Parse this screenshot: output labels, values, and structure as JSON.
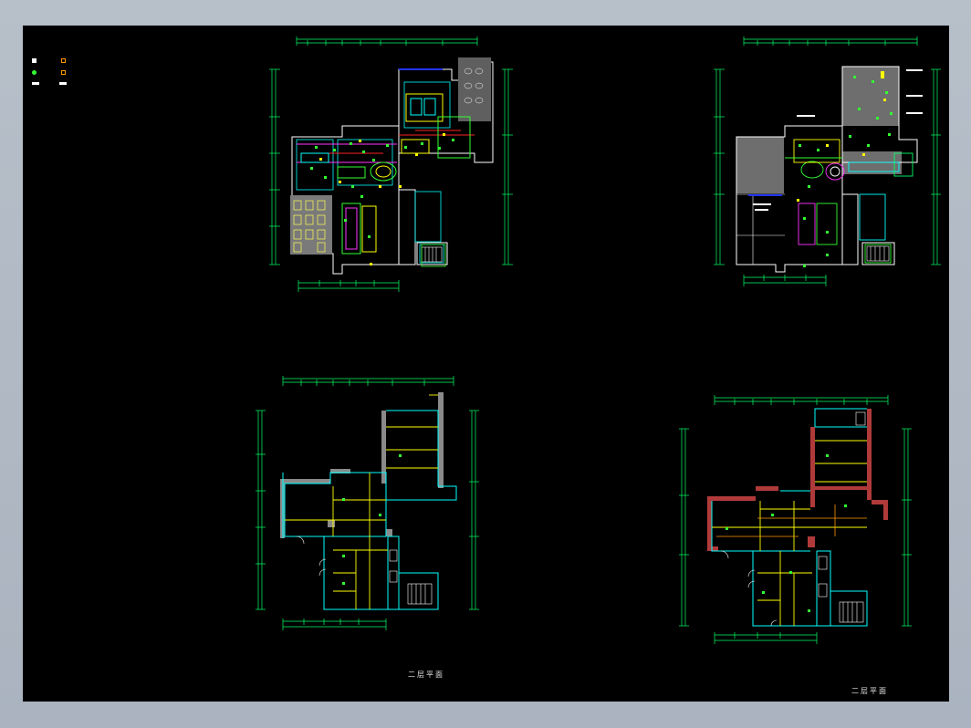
{
  "window": {
    "background": "#b7bfc9",
    "canvas_color": "#000000"
  },
  "legend": [
    {
      "symbol_color": "#ffffff",
      "sample_color": "#ff9900"
    },
    {
      "symbol_color": "#33ff33",
      "sample_color": "#ff9900"
    },
    {
      "symbol_color": "#ffffff",
      "sample_color": "#ffffff"
    }
  ],
  "drawings": {
    "plan_top_left": {
      "caption": ""
    },
    "plan_top_right": {
      "caption": ""
    },
    "plan_bottom_left": {
      "caption": "二层平面"
    },
    "plan_bottom_right": {
      "caption": "二层平面"
    }
  },
  "colors": {
    "wall": "#ffffff",
    "dimension": "#00ff66",
    "cyan": "#00ffff",
    "yellow": "#ffff00",
    "red": "#ff2222",
    "magenta": "#ff33ff",
    "blue": "#2233ff",
    "concrete": "#8a8a8a",
    "brick": "#b03a3a"
  }
}
